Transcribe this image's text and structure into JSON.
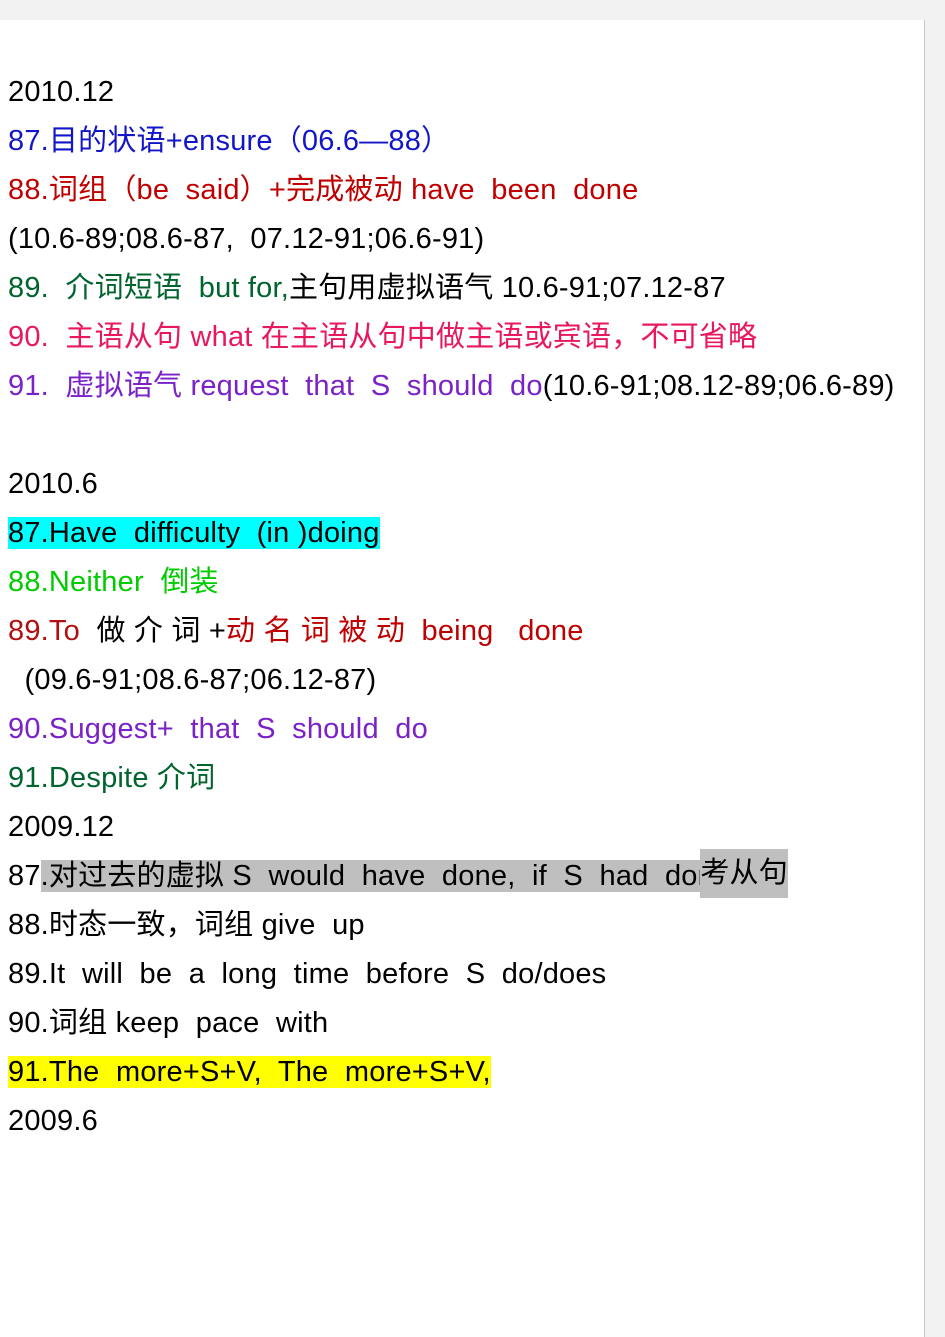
{
  "document": {
    "title": "2010.12",
    "page_background": "#ffffff",
    "canvas_background": "#f2f2f2",
    "colors": {
      "black": "#000000",
      "blue": "#1316c8",
      "red": "#c00000",
      "dark_red": "#b01010",
      "dark_green": "#00642e",
      "bright_green": "#00cc00",
      "pink": "#e8185c",
      "purple": "#7a22c8",
      "highlight_cyan": "#00ffff",
      "highlight_yellow": "#ffff00",
      "highlight_gray": "#bfbfbf"
    }
  },
  "sections": [
    {
      "heading": "2010.12",
      "entries": [
        {
          "number": "87.",
          "parts": [
            {
              "text": "87.目的状语+ensure（06.6—88）",
              "color": "blue",
              "highlight": "none"
            }
          ]
        },
        {
          "number": "88.",
          "parts": [
            {
              "text": "88.词组（be  said）+完成被动 have  been  done",
              "color": "red",
              "highlight": "none"
            },
            {
              "text": "(10.6-89;08.6-87,  07.12-91;06.6-91)",
              "color": "black",
              "highlight": "none"
            }
          ]
        },
        {
          "number": "89.",
          "parts": [
            {
              "text": "89.  介词短语  but for,",
              "color": "dark_green",
              "highlight": "none"
            },
            {
              "text": "主句用虚拟语气 10.6-91;07.12-87",
              "color": "black",
              "highlight": "none"
            }
          ]
        },
        {
          "number": "90.",
          "parts": [
            {
              "text": "90.  主语从句 what 在主语从句中做主语或宾语，不可省略",
              "color": "pink",
              "highlight": "none"
            }
          ]
        },
        {
          "number": "91.",
          "parts": [
            {
              "text": "91.  虚拟语气 request  that  S  should  do",
              "color": "purple",
              "highlight": "none"
            },
            {
              "text": "(10.6-91;08.12-89;06.6-89)",
              "color": "black",
              "highlight": "none"
            }
          ]
        }
      ]
    },
    {
      "heading": "2010.6",
      "entries": [
        {
          "number": "87.",
          "parts": [
            {
              "text": "87.Have  difficulty  (in )doing",
              "color": "black",
              "highlight": "cyan"
            }
          ]
        },
        {
          "number": "88.",
          "parts": [
            {
              "text": "88.Neither  倒装",
              "color": "bright_green",
              "highlight": "none"
            }
          ]
        },
        {
          "number": "89.",
          "parts": [
            {
              "text": "89.To",
              "color": "dark_red",
              "highlight": "none"
            },
            {
              "text": "  做 介 词 +",
              "color": "black",
              "highlight": "none"
            },
            {
              "text": "动 名 词 被 动  being   done",
              "color": "red",
              "highlight": "none"
            },
            {
              "text": "  (09.6-91;08.6-87;06.12-87)",
              "color": "black",
              "highlight": "none"
            }
          ]
        },
        {
          "number": "90.",
          "parts": [
            {
              "text": "90.Suggest+  that  S  should  do",
              "color": "purple",
              "highlight": "none"
            }
          ]
        },
        {
          "number": "91.",
          "parts": [
            {
              "text": "91.Despite 介词",
              "color": "dark_green",
              "highlight": "none"
            }
          ]
        }
      ]
    },
    {
      "heading": "2009.12",
      "entries": [
        {
          "number": "87.",
          "parts": [
            {
              "text": "87",
              "color": "black",
              "highlight": "none"
            },
            {
              "text": ".对过去的虚拟 S  would  have  done,  if  S  had  done",
              "color": "black",
              "highlight": "gray"
            },
            {
              "text": "考从句",
              "color": "black",
              "highlight": "gray",
              "overlap": true
            }
          ]
        },
        {
          "number": "88.",
          "parts": [
            {
              "text": "88.时态一致，词组 give  up",
              "color": "black",
              "highlight": "none"
            }
          ]
        },
        {
          "number": "89.",
          "parts": [
            {
              "text": "89.It  will  be  a  long  time  before  S  do/does",
              "color": "black",
              "highlight": "none"
            }
          ]
        },
        {
          "number": "90.",
          "parts": [
            {
              "text": "90.词组 keep  pace  with",
              "color": "black",
              "highlight": "none"
            }
          ]
        },
        {
          "number": "91.",
          "parts": [
            {
              "text": "91.The  more+S+V,  The  more+S+V,",
              "color": "black",
              "highlight": "yellow"
            }
          ]
        }
      ]
    },
    {
      "heading": "2009.6",
      "entries": []
    }
  ],
  "overlap_text": {
    "line_87_2009_12_tail": "考从句"
  }
}
